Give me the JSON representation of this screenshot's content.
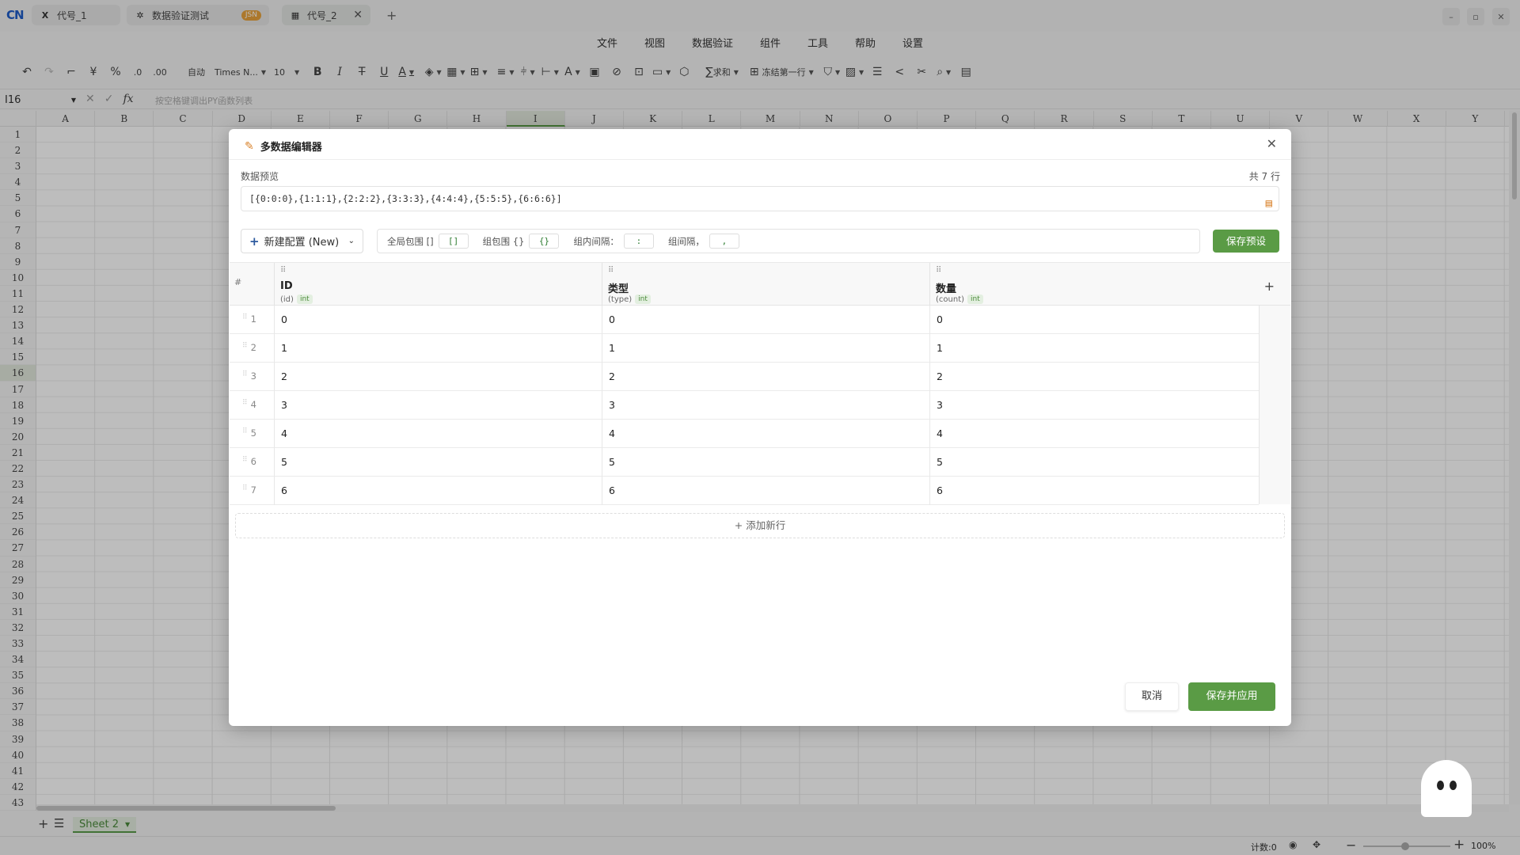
{
  "tabs": [
    {
      "label": "代号_1",
      "icon": "excel-x-icon"
    },
    {
      "label": "数据验证测试",
      "icon": "brain-icon",
      "badge": "JSN"
    },
    {
      "label": "代号_2",
      "icon": "sheet-icon"
    }
  ],
  "menu": [
    "文件",
    "视图",
    "数据验证",
    "组件",
    "工具",
    "帮助",
    "设置"
  ],
  "toolbar": {
    "format_auto": "自动",
    "font_name": "Times N...",
    "font_size": "10",
    "currency": "¥",
    "percent": "%",
    "sum": "求和",
    "freeze": "冻结第一行"
  },
  "formula_bar": {
    "name_box": "I16",
    "fx": "fx",
    "placeholder": "按空格键调出PY函数列表"
  },
  "columns": [
    "A",
    "B",
    "C",
    "D",
    "E",
    "F",
    "G",
    "H",
    "I",
    "J",
    "K",
    "L",
    "M",
    "N",
    "O",
    "P",
    "Q",
    "R",
    "S",
    "T",
    "U",
    "V",
    "W",
    "X",
    "Y"
  ],
  "row_count": 43,
  "selected_cell": {
    "column": "I",
    "row": 16
  },
  "sheet": {
    "name": "Sheet 2"
  },
  "status": {
    "count_label": "计数:0",
    "zoom": "100%"
  },
  "dialog": {
    "title": "多数据编辑器",
    "preview_label": "数据预览",
    "row_total": "共 7 行",
    "preview_text": "[{0:0:0},{1:1:1},{2:2:2},{3:3:3},{4:4:4},{5:5:5},{6:6:6}]",
    "config_select": "新建配置 (New)",
    "opt_global_label": "全局包围 []",
    "opt_global_value": "[]",
    "opt_group_label": "组包围 {}",
    "opt_group_value": "{}",
    "opt_inner_label": "组内间隔：",
    "opt_inner_value": ":",
    "opt_between_label": "组间隔，",
    "opt_between_value": ",",
    "save_preset": "保存预设",
    "table": {
      "num_header": "#",
      "columns": [
        {
          "name": "ID",
          "key": "(id)",
          "type": "int"
        },
        {
          "name": "类型",
          "key": "(type)",
          "type": "int"
        },
        {
          "name": "数量",
          "key": "(count)",
          "type": "int"
        }
      ],
      "rows": [
        {
          "n": "1",
          "cells": [
            "0",
            "0",
            "0"
          ]
        },
        {
          "n": "2",
          "cells": [
            "1",
            "1",
            "1"
          ]
        },
        {
          "n": "3",
          "cells": [
            "2",
            "2",
            "2"
          ]
        },
        {
          "n": "4",
          "cells": [
            "3",
            "3",
            "3"
          ]
        },
        {
          "n": "5",
          "cells": [
            "4",
            "4",
            "4"
          ]
        },
        {
          "n": "6",
          "cells": [
            "5",
            "5",
            "5"
          ]
        },
        {
          "n": "7",
          "cells": [
            "6",
            "6",
            "6"
          ]
        }
      ]
    },
    "add_row": "+ 添加新行",
    "cancel": "取消",
    "apply": "保存并应用"
  },
  "colors": {
    "accent_green": "#5a9b45",
    "brand_blue": "#1e5cc8",
    "badge_orange": "#e8a33c"
  }
}
